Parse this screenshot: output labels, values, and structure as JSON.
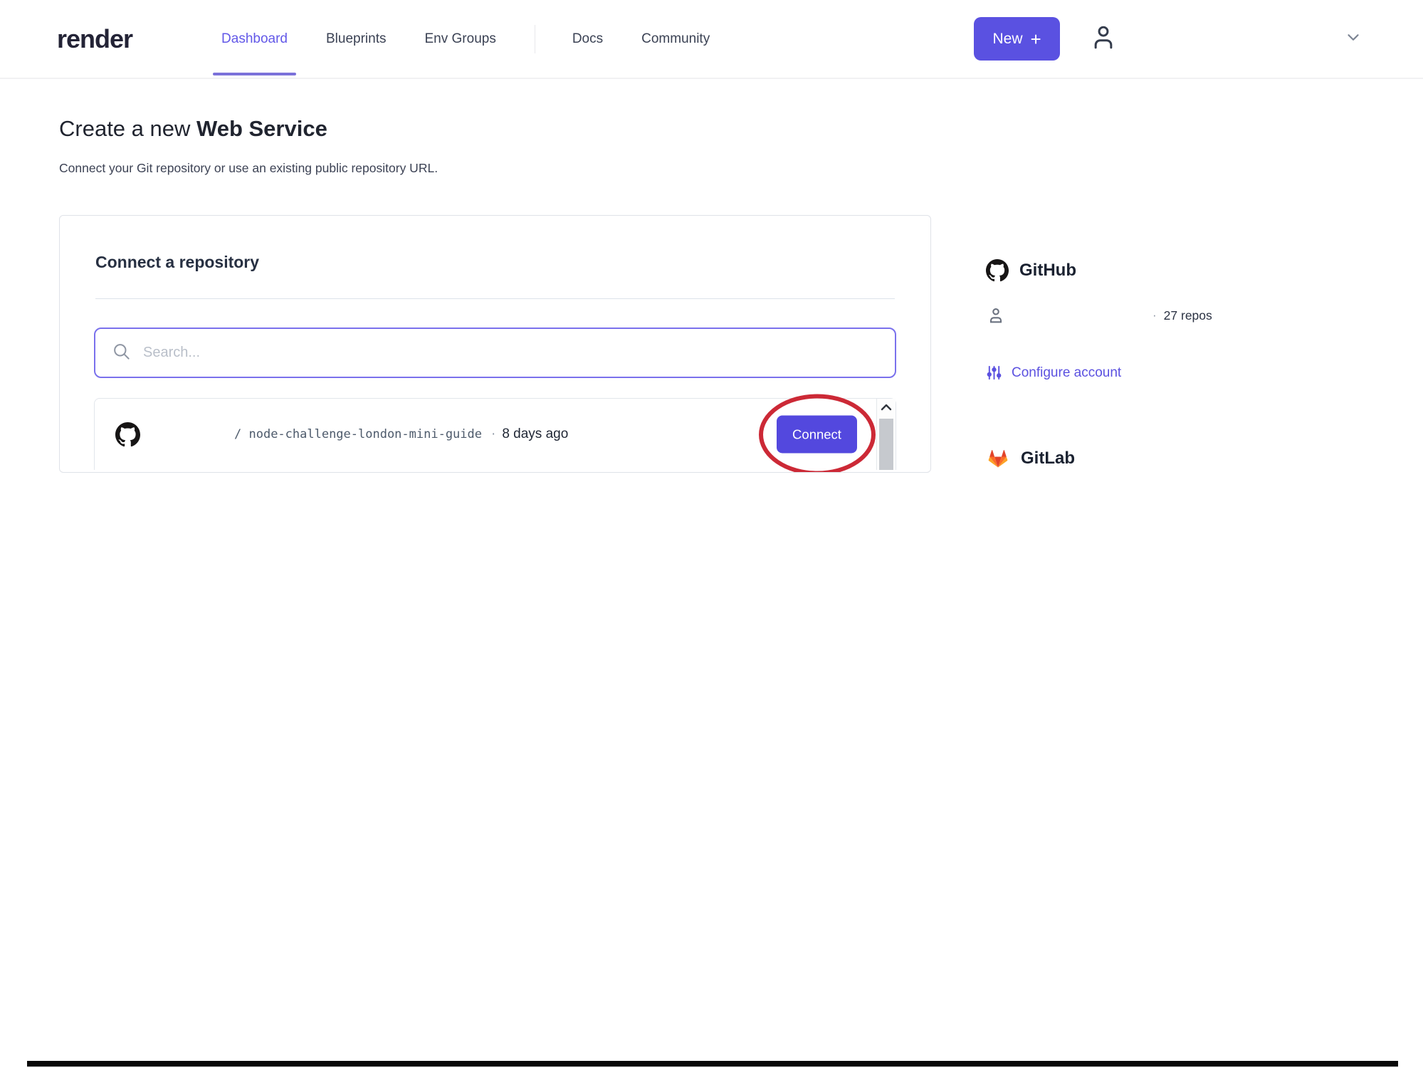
{
  "nav": {
    "logo": "render",
    "items": [
      {
        "label": "Dashboard",
        "active": true
      },
      {
        "label": "Blueprints",
        "active": false
      },
      {
        "label": "Env Groups",
        "active": false
      },
      {
        "label": "Docs",
        "active": false
      },
      {
        "label": "Community",
        "active": false
      }
    ],
    "new_button": {
      "label": "New",
      "plus": "+"
    }
  },
  "page": {
    "title_prefix": "Create a new ",
    "title_emphasis": "Web Service",
    "subtitle": "Connect your Git repository or use an existing public repository URL."
  },
  "connect_card": {
    "title": "Connect a repository",
    "search": {
      "placeholder": "Search...",
      "value": ""
    },
    "repos": [
      {
        "path_separator": "/ ",
        "name": "node-challenge-london-mini-guide",
        "separator": "·",
        "updated": "8 days ago",
        "action_label": "Connect"
      }
    ]
  },
  "sidebar": {
    "github": {
      "title": "GitHub",
      "account": {
        "separator": "·",
        "repo_count": "27 repos"
      },
      "configure_label": "Configure account"
    },
    "gitlab": {
      "title": "GitLab"
    }
  },
  "colors": {
    "accent": "#5A51E1",
    "accent_link": "#5B51E0",
    "nav_active": "#6258E8",
    "search_border": "#7A71EC",
    "annotation_red": "#CC2936",
    "gitlab_orange": "#FC6D26",
    "github_black": "#171515"
  }
}
